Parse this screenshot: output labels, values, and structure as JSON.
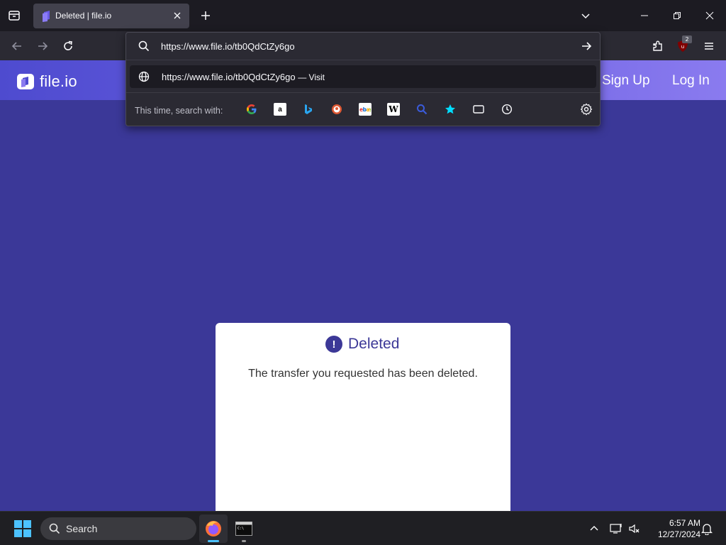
{
  "browser": {
    "tab": {
      "title": "Deleted | file.io"
    },
    "url": "https://www.file.io/tb0QdCtZy6go",
    "extension_badge": "2",
    "dropdown": {
      "result_url": "https://www.file.io/tb0QdCtZy6go",
      "result_action": "— Visit",
      "search_with_label": "This time, search with:",
      "engines": [
        "google-icon",
        "amazon-icon",
        "bing-icon",
        "duckduckgo-icon",
        "ebay-icon",
        "wikipedia-icon",
        "search-engine-icon",
        "bookmarks-star-icon",
        "tabs-icon",
        "history-icon"
      ]
    }
  },
  "site": {
    "name": "file.io",
    "nav": {
      "signup": "Sign Up",
      "login": "Log In"
    }
  },
  "card": {
    "title": "Deleted",
    "icon_glyph": "!",
    "message": "The transfer you requested has been deleted."
  },
  "taskbar": {
    "search_label": "Search",
    "time": "6:57 AM",
    "date": "12/27/2024"
  },
  "colors": {
    "page_bg": "#3b3898",
    "accent": "#3c3897",
    "header_gradient_start": "#4e4bcf",
    "header_gradient_end": "#8a7bef"
  }
}
